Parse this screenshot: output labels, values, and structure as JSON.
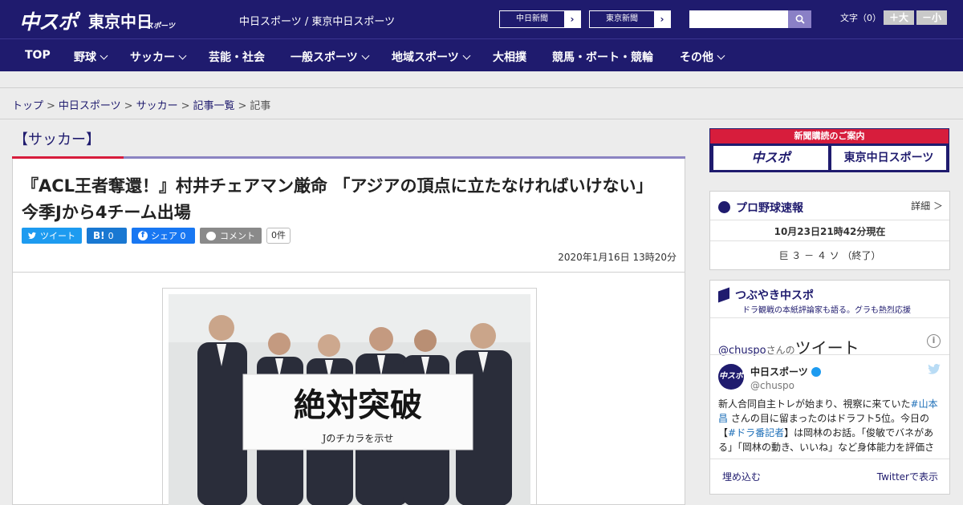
{
  "header": {
    "logo_chuspo": "中スポ",
    "logo_tokyo": "東京中日",
    "logo_tokyo_sub": "スポーツ",
    "site_name": "中日スポーツ / 東京中日スポーツ",
    "paper_links": [
      {
        "label": "中日新聞"
      },
      {
        "label": "東京新聞"
      }
    ],
    "search_placeholder": "",
    "font_size_label": "文字（0）",
    "font_up": "＋大",
    "font_down": "－小"
  },
  "nav": [
    {
      "label": "TOP",
      "dropdown": false
    },
    {
      "label": "野球",
      "dropdown": true
    },
    {
      "label": "サッカー",
      "dropdown": true
    },
    {
      "label": "芸能・社会",
      "dropdown": false
    },
    {
      "label": "一般スポーツ",
      "dropdown": true
    },
    {
      "label": "地域スポーツ",
      "dropdown": true
    },
    {
      "label": "大相撲",
      "dropdown": false
    },
    {
      "label": "競馬・ボート・競輪",
      "dropdown": false
    },
    {
      "label": "その他",
      "dropdown": true
    }
  ],
  "breadcrumb": [
    {
      "label": "トップ",
      "link": true
    },
    {
      "label": "中日スポーツ",
      "link": true
    },
    {
      "label": "サッカー",
      "link": true
    },
    {
      "label": "記事一覧",
      "link": true
    },
    {
      "label": "記事",
      "link": false
    }
  ],
  "article": {
    "category": "【サッカー】",
    "headline": "『ACL王者奪還！』村井チェアマン厳命 「アジアの頂点に立たなければいけない」今季Jから4チーム出場",
    "share": {
      "tweet": "ツイート",
      "hatena_icon": "B!",
      "hatena_count": "0",
      "fb_label": "シェア",
      "fb_count": "0",
      "comment": "コメント",
      "comment_count": "0件"
    },
    "date": "2020年1月16日 13時20分",
    "photo_banner_text": "絶対突破",
    "photo_banner_sub": "Jのチカラを示せ"
  },
  "sidebar": {
    "ad": {
      "title": "新聞購読のご案内",
      "logo1": "中スポ",
      "logo2": "東京中日スポーツ"
    },
    "baseball": {
      "title": "プロ野球速報",
      "detail": "詳細 ＞",
      "updated": "10月23日21時42分現在",
      "score": "巨 ３ － ４ ソ （終了）"
    },
    "tweets": {
      "title": "つぶやき中スポ",
      "subtitle": "ドラ観戦の本紙評論家も語る。グラも熱烈応援",
      "head_user": "@chuspo",
      "head_suffix": "さんの",
      "head_big": "ツイート",
      "avatar_text": "中スポ",
      "name": "中日スポーツ",
      "handle": "@chuspo",
      "body_1": "新人合同自主トレが始まり、視察に来ていた",
      "body_hl1": "#山本昌",
      "body_2": " さんの目に留まったのはドラフト5位。今日の【",
      "body_hl2": "#ドラ番記者",
      "body_3": "】は岡林のお話。「俊敏でバネがある」「岡林の動き、いいね」など身体能力を評価さ",
      "embed": "埋め込む",
      "view_on": "Twitterで表示"
    }
  }
}
